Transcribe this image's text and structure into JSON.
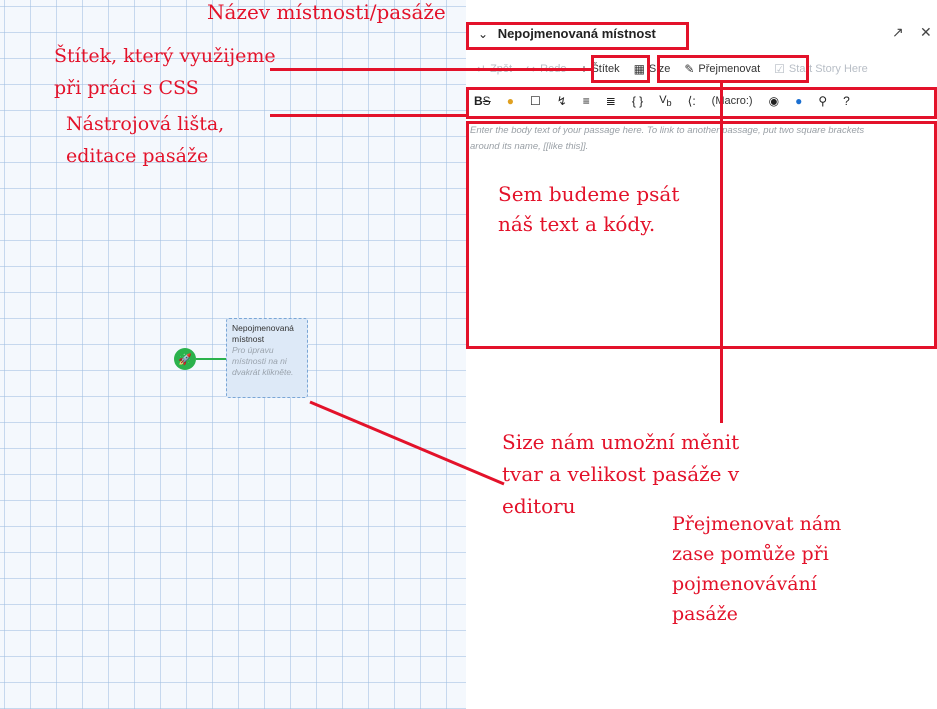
{
  "story_map": {
    "passage": {
      "title_line1": "Nepojmenovaná",
      "title_line2": "místnost",
      "excerpt_line1": "Pro úpravu",
      "excerpt_line2": "místnosti na ni",
      "excerpt_line3": "dvakrát klikněte."
    }
  },
  "dialog": {
    "title": "Nepojmenovaná místnost",
    "actions": {
      "undo": "Zpět",
      "redo": "Redo",
      "tag": "Štítek",
      "size": "Size",
      "rename": "Přejmenovat",
      "start": "Start Story Here"
    },
    "toolbar": {
      "macro": "(Macro:)"
    },
    "placeholder_line1": "Enter the body text of your passage here. To link to another passage, put two square brackets",
    "placeholder_line2": "around its name, [[like this]]."
  },
  "annotations": {
    "room_name": "Název místnosti/pasáže",
    "tag_line1": "Štítek, který využijeme",
    "tag_line2": "při práci s CSS",
    "toolbar_line1": "Nástrojová lišta,",
    "toolbar_line2": "editace pasáže",
    "body_line1": "Sem budeme psát",
    "body_line2": "náš text a kódy.",
    "size_line1": "Size nám umožní měnit",
    "size_line2": "tvar a velikost pasáže v",
    "size_line3": "editoru",
    "rename_line1": "Přejmenovat nám",
    "rename_line2": "zase pomůže při",
    "rename_line3": "pojmenovávání",
    "rename_line4": "pasáže"
  },
  "icons": [
    "chevron-down-icon",
    "expand-icon",
    "close-icon",
    "undo-icon",
    "redo-icon",
    "plus-icon",
    "size-icon",
    "rename-icon",
    "checkbox-icon",
    "start-icon",
    "bold-strike-icon",
    "color-icon",
    "square-icon",
    "link-icon",
    "list-icon",
    "align-icon",
    "braces-icon",
    "variable-icon",
    "collapse-icon",
    "eye-icon",
    "comment-icon",
    "search-icon",
    "help-icon"
  ],
  "colors": {
    "annotation": "#e3122a",
    "start_marker": "#2bb24c",
    "passage_fill": "#dde9f7",
    "comment_icon": "#1a6fd1"
  }
}
